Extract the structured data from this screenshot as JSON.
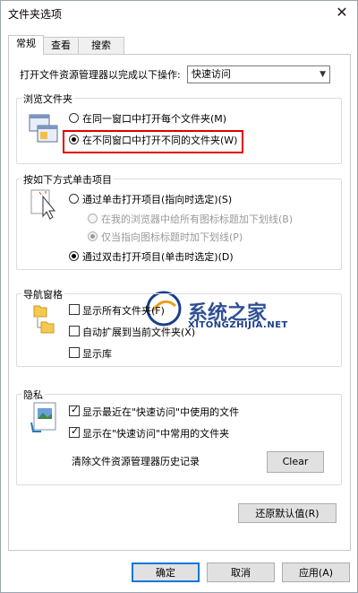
{
  "window": {
    "title": "文件夹选项"
  },
  "tabs": [
    {
      "label": "常规",
      "active": true
    },
    {
      "label": "查看",
      "active": false
    },
    {
      "label": "搜索",
      "active": false
    }
  ],
  "open_explorer": {
    "label": "打开文件资源管理器以完成以下操作:",
    "value": "快速访问"
  },
  "browse_folders": {
    "title": "浏览文件夹",
    "options": [
      {
        "label": "在同一窗口中打开每个文件夹(M)",
        "selected": false
      },
      {
        "label": "在不同窗口中打开不同的文件夹(W)",
        "selected": true
      }
    ],
    "highlight_color": "#e00000"
  },
  "click_items": {
    "title": "按如下方式单击项目",
    "single_click": "通过单击打开项目(指向时选定)(S)",
    "underline_browser": "在我的浏览器中给所有图标标题加下划线(B)",
    "underline_point": "仅当指向图标标题时加下划线(P)",
    "double_click": "通过双击打开项目(单击时选定)(D)"
  },
  "nav_pane": {
    "title": "导航窗格",
    "show_all_folders": "显示所有文件夹(F)",
    "expand_to_current": "自动扩展到当前文件夹(X)",
    "show_libraries": "显示库"
  },
  "privacy": {
    "title": "隐私",
    "recent_files": "显示最近在\"快速访问\"中使用的文件",
    "frequent_folders": "显示在\"快速访问\"中常用的文件夹",
    "clear_history_label": "清除文件资源管理器历史记录",
    "clear_button": "Clear"
  },
  "restore_defaults": "还原默认值(R)",
  "footer": {
    "ok": "确定",
    "cancel": "取消",
    "apply": "应用(A)"
  },
  "watermark": {
    "name": "系统之家",
    "url": "XITONGZHIJIA.NET"
  },
  "colors": {
    "default_button_border": "#0078d7",
    "watermark": "#1a3e8a"
  }
}
